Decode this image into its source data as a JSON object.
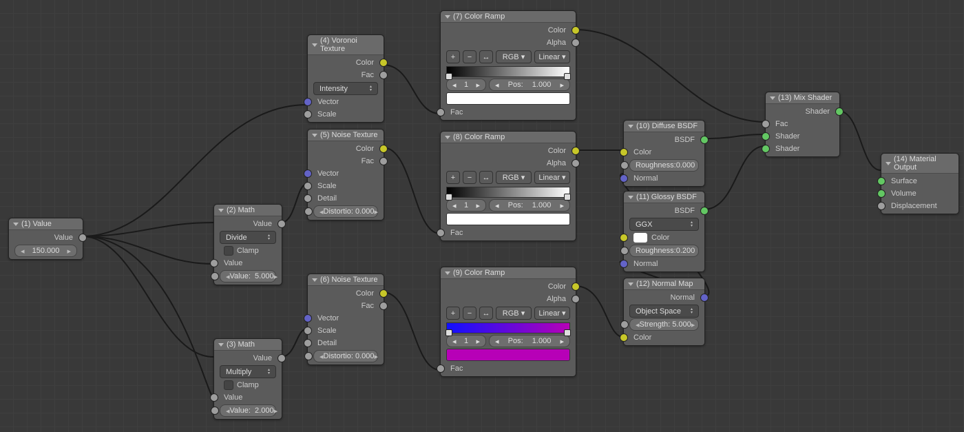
{
  "nodes": {
    "value": {
      "title": "(1) Value",
      "outputs": [
        "Value"
      ],
      "field_val": "150.000"
    },
    "math1": {
      "title": "(2) Math",
      "outputs": [
        "Value"
      ],
      "mode": "Divide",
      "clamp": "Clamp",
      "inputs": [
        "Value"
      ],
      "field_label": "Value:",
      "field_val": "5.000"
    },
    "math2": {
      "title": "(3) Math",
      "outputs": [
        "Value"
      ],
      "mode": "Multiply",
      "clamp": "Clamp",
      "inputs": [
        "Value"
      ],
      "field_label": "Value:",
      "field_val": "2.000"
    },
    "voronoi": {
      "title": "(4) Voronoi Texture",
      "outputs": [
        "Color",
        "Fac"
      ],
      "mode": "Intensity",
      "inputs": [
        "Vector",
        "Scale"
      ]
    },
    "noise1": {
      "title": "(5) Noise Texture",
      "outputs": [
        "Color",
        "Fac"
      ],
      "inputs": [
        "Vector",
        "Scale",
        "Detail"
      ],
      "dist_label": "Distortio:",
      "dist_val": "0.000"
    },
    "noise2": {
      "title": "(6) Noise Texture",
      "outputs": [
        "Color",
        "Fac"
      ],
      "inputs": [
        "Vector",
        "Scale",
        "Detail"
      ],
      "dist_label": "Distortio:",
      "dist_val": "0.000"
    },
    "ramp1": {
      "title": "(7) Color Ramp",
      "outputs": [
        "Color",
        "Alpha"
      ],
      "mode1": "RGB",
      "mode2": "Linear",
      "idx": "1",
      "pos_label": "Pos:",
      "pos": "1.000",
      "swatch": "#ffffff",
      "fac": "Fac"
    },
    "ramp2": {
      "title": "(8) Color Ramp",
      "outputs": [
        "Color",
        "Alpha"
      ],
      "mode1": "RGB",
      "mode2": "Linear",
      "idx": "1",
      "pos_label": "Pos:",
      "pos": "1.000",
      "swatch": "#ffffff",
      "fac": "Fac"
    },
    "ramp3": {
      "title": "(9) Color Ramp",
      "outputs": [
        "Color",
        "Alpha"
      ],
      "mode1": "RGB",
      "mode2": "Linear",
      "idx": "1",
      "pos_label": "Pos:",
      "pos": "1.000",
      "swatch": "#b700b7",
      "fac": "Fac",
      "grad_l": "#1010ff",
      "grad_r": "#b700b7"
    },
    "diffuse": {
      "title": "(10) Diffuse BSDF",
      "outputs": [
        "BSDF"
      ],
      "inputs": [
        "Color",
        "Normal"
      ],
      "rough_label": "Roughness:",
      "rough_val": "0.000"
    },
    "glossy": {
      "title": "(11) Glossy BSDF",
      "outputs": [
        "BSDF"
      ],
      "mode": "GGX",
      "inputs": [
        "Color",
        "Normal"
      ],
      "rough_label": "Roughness:",
      "rough_val": "0.200",
      "color_label": "Color"
    },
    "normal": {
      "title": "(12) Normal Map",
      "outputs": [
        "Normal"
      ],
      "mode": "Object Space",
      "str_label": "Strength:",
      "str_val": "5.000",
      "inputs": [
        "Color"
      ]
    },
    "mix": {
      "title": "(13) Mix Shader",
      "outputs": [
        "Shader"
      ],
      "inputs": [
        "Fac",
        "Shader",
        "Shader"
      ]
    },
    "out": {
      "title": "(14) Material Output",
      "inputs": [
        "Surface",
        "Volume",
        "Displacement"
      ]
    }
  },
  "icons": {
    "plus": "+",
    "minus": "−",
    "flip": "↔",
    "chev": "▾",
    "left": "◂",
    "right": "▸"
  }
}
